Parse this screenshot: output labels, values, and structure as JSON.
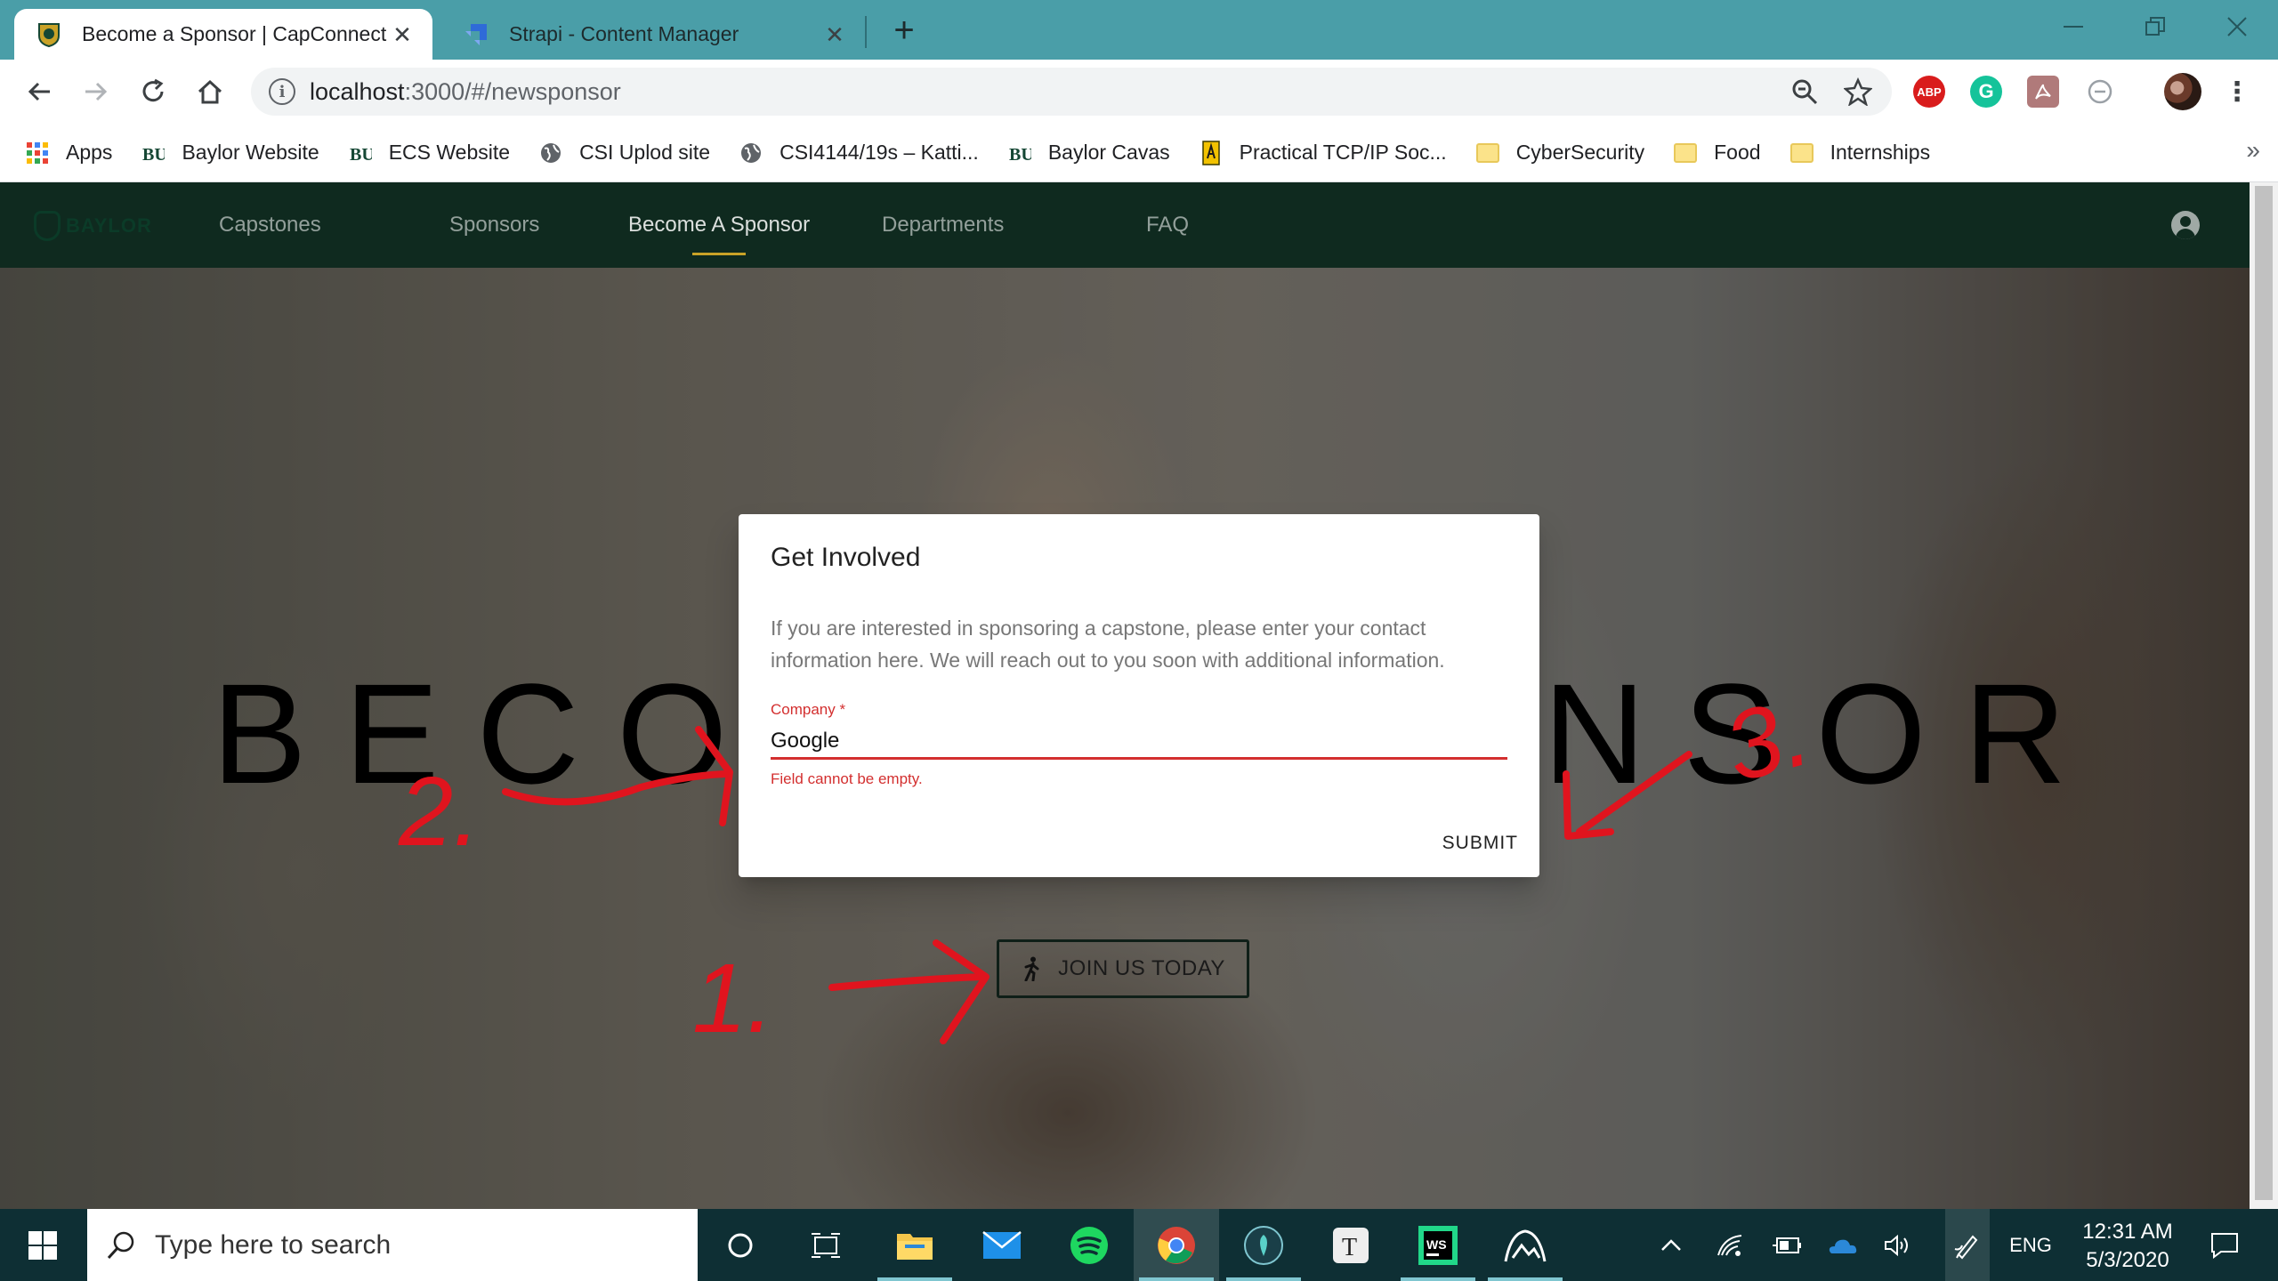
{
  "browser": {
    "tabs": [
      {
        "title": "Become a Sponsor | CapConnect",
        "active": true
      },
      {
        "title": "Strapi - Content Manager",
        "active": false
      }
    ],
    "url_host": "localhost",
    "url_path": ":3000/#/newsponsor",
    "bookmarks": [
      {
        "label": "Apps",
        "icon": "apps-grid-icon"
      },
      {
        "label": "Baylor Website",
        "icon": "baylor-bu-icon"
      },
      {
        "label": "ECS Website",
        "icon": "baylor-bu-icon"
      },
      {
        "label": "CSI Uplod site",
        "icon": "globe-icon"
      },
      {
        "label": "CSI4144/19s – Katti...",
        "icon": "globe-icon"
      },
      {
        "label": "Baylor Cavas",
        "icon": "baylor-bu-icon"
      },
      {
        "label": "Practical TCP/IP Soc...",
        "icon": "book-icon"
      },
      {
        "label": "CyberSecurity",
        "icon": "folder-icon"
      },
      {
        "label": "Food",
        "icon": "folder-icon"
      },
      {
        "label": "Internships",
        "icon": "folder-icon"
      }
    ],
    "more_bookmarks": "»",
    "extensions": [
      "ABP"
    ]
  },
  "app": {
    "logo_text": "BAYLOR",
    "nav": [
      {
        "label": "Capstones",
        "active": false
      },
      {
        "label": "Sponsors",
        "active": false
      },
      {
        "label": "Become A Sponsor",
        "active": true
      },
      {
        "label": "Departments",
        "active": false
      },
      {
        "label": "FAQ",
        "active": false
      }
    ],
    "hero_title_left": "BECOM",
    "hero_title_right": "NSOR",
    "join_button": "JOIN US TODAY"
  },
  "dialog": {
    "title": "Get Involved",
    "text": "If you are interested in sponsoring a capstone, please enter your contact information here. We will reach out to you soon with additional information.",
    "field_label": "Company *",
    "field_value": "Google",
    "field_error": "Field cannot be empty.",
    "submit": "SUBMIT"
  },
  "annotations": {
    "numbers": [
      "1.",
      "2.",
      "3."
    ],
    "color": "#e0141e"
  },
  "taskbar": {
    "search_placeholder": "Type here to search",
    "language": "ENG",
    "time": "12:31 AM",
    "date": "5/3/2020"
  },
  "colors": {
    "chrome_frame": "#4a9ea8",
    "app_nav": "#0f2a1f",
    "accent_gold": "#c9a227",
    "error_red": "#d32f2f",
    "taskbar": "#0e2f34"
  }
}
